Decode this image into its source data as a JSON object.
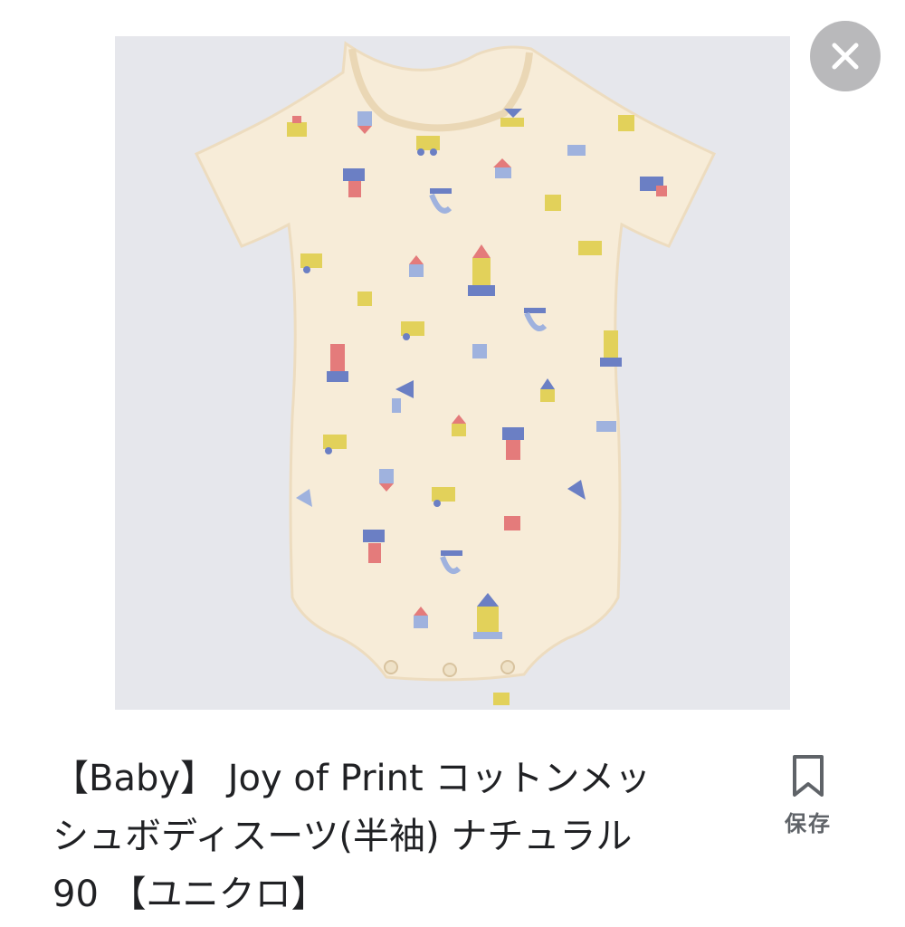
{
  "product_image": {
    "alt": "Baby short-sleeve mesh bodysuit with toy print"
  },
  "close_button": {
    "icon": "close-icon"
  },
  "caption": {
    "line1": "【Baby】 Joy of Print コットンメッ",
    "line2": "シュボディスーツ(半袖) ナチュラル",
    "line3": "90 【ユニクロ】"
  },
  "save": {
    "icon": "bookmark-icon",
    "label": "保存"
  },
  "colors": {
    "image_background": "#e6e7ec",
    "garment": "#f7ecd8",
    "close_circle": "#b9b9bb",
    "text": "#202124",
    "muted_text": "#5f6368"
  }
}
